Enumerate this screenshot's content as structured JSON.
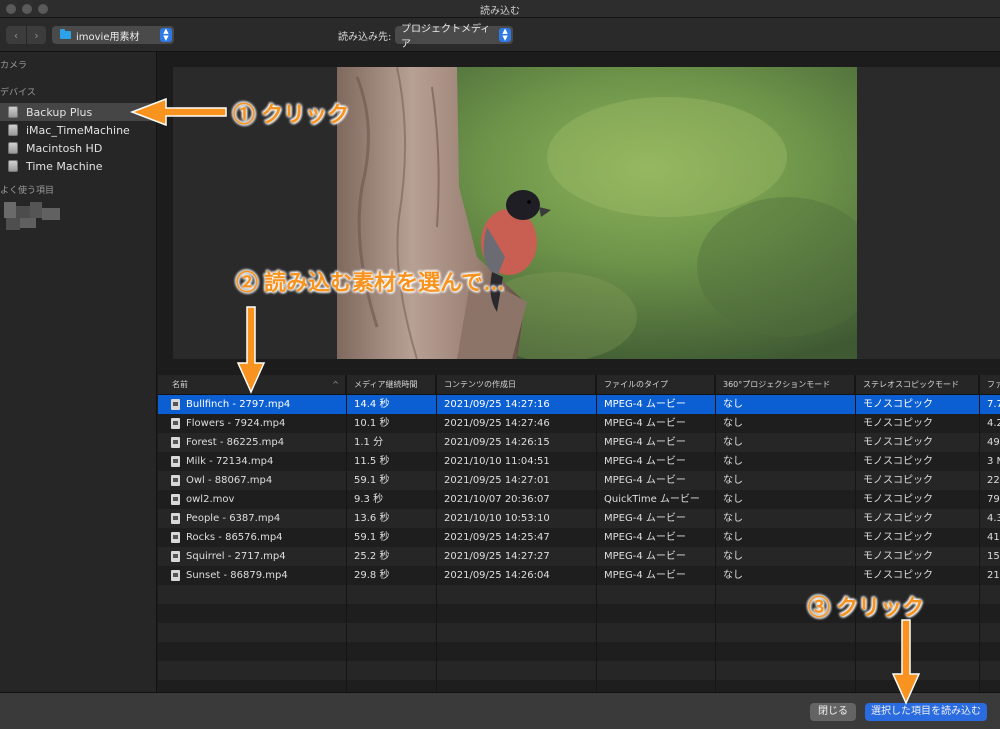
{
  "window": {
    "title": "読み込む"
  },
  "toolbar": {
    "back_symbol": "‹",
    "forward_symbol": "›",
    "library_popup": "imovie用素材",
    "import_to_label": "読み込み先:",
    "import_to_popup": "プロジェクトメディア"
  },
  "sidebar": {
    "sections": [
      {
        "label": "カメラ"
      },
      {
        "label": "デバイス"
      },
      {
        "label": "よく使う項目"
      }
    ],
    "devices": [
      {
        "label": "Backup Plus",
        "selected": true
      },
      {
        "label": "iMac_TimeMachine",
        "selected": false
      },
      {
        "label": "Macintosh HD",
        "selected": false
      },
      {
        "label": "Time Machine",
        "selected": false
      }
    ]
  },
  "table": {
    "columns": [
      "名前",
      "メディア継続時間",
      "コンテンツの作成日",
      "ファイルのタイプ",
      "360°プロジェクションモード",
      "ステレオスコピックモード",
      "ファ"
    ],
    "rows": [
      [
        "Bullfinch - 2797.mp4",
        "14.4 秒",
        "2021/09/25 14:27:16",
        "MPEG-4 ムービー",
        "なし",
        "モノスコピック",
        "7.7"
      ],
      [
        "Flowers - 7924.mp4",
        "10.1 秒",
        "2021/09/25 14:27:46",
        "MPEG-4 ムービー",
        "なし",
        "モノスコピック",
        "4.2"
      ],
      [
        "Forest - 86225.mp4",
        "1.1 分",
        "2021/09/25 14:26:15",
        "MPEG-4 ムービー",
        "なし",
        "モノスコピック",
        "49"
      ],
      [
        "Milk - 72134.mp4",
        "11.5 秒",
        "2021/10/10 11:04:51",
        "MPEG-4 ムービー",
        "なし",
        "モノスコピック",
        "3 M"
      ],
      [
        "Owl - 88067.mp4",
        "59.1 秒",
        "2021/09/25 14:27:01",
        "MPEG-4 ムービー",
        "なし",
        "モノスコピック",
        "22"
      ],
      [
        "owl2.mov",
        "9.3 秒",
        "2021/10/07 20:36:07",
        "QuickTime ムービー",
        "なし",
        "モノスコピック",
        "79"
      ],
      [
        "People - 6387.mp4",
        "13.6 秒",
        "2021/10/10 10:53:10",
        "MPEG-4 ムービー",
        "なし",
        "モノスコピック",
        "4.3"
      ],
      [
        "Rocks - 86576.mp4",
        "59.1 秒",
        "2021/09/25 14:25:47",
        "MPEG-4 ムービー",
        "なし",
        "モノスコピック",
        "41"
      ],
      [
        "Squirrel - 2717.mp4",
        "25.2 秒",
        "2021/09/25 14:27:27",
        "MPEG-4 ムービー",
        "なし",
        "モノスコピック",
        "15"
      ],
      [
        "Sunset - 86879.mp4",
        "29.8 秒",
        "2021/09/25 14:26:04",
        "MPEG-4 ムービー",
        "なし",
        "モノスコピック",
        "21"
      ]
    ],
    "selected_row": 0
  },
  "footer": {
    "close_label": "閉じる",
    "import_selected_label": "選択した項目を読み込む"
  },
  "annotations": {
    "step1": "① クリック",
    "step2": "② 読み込む素材を選んで…",
    "step3": "③ クリック"
  },
  "colors": {
    "accent": "#f7931e",
    "selection": "#0b5fd3",
    "primary_button": "#2a6ce0"
  }
}
